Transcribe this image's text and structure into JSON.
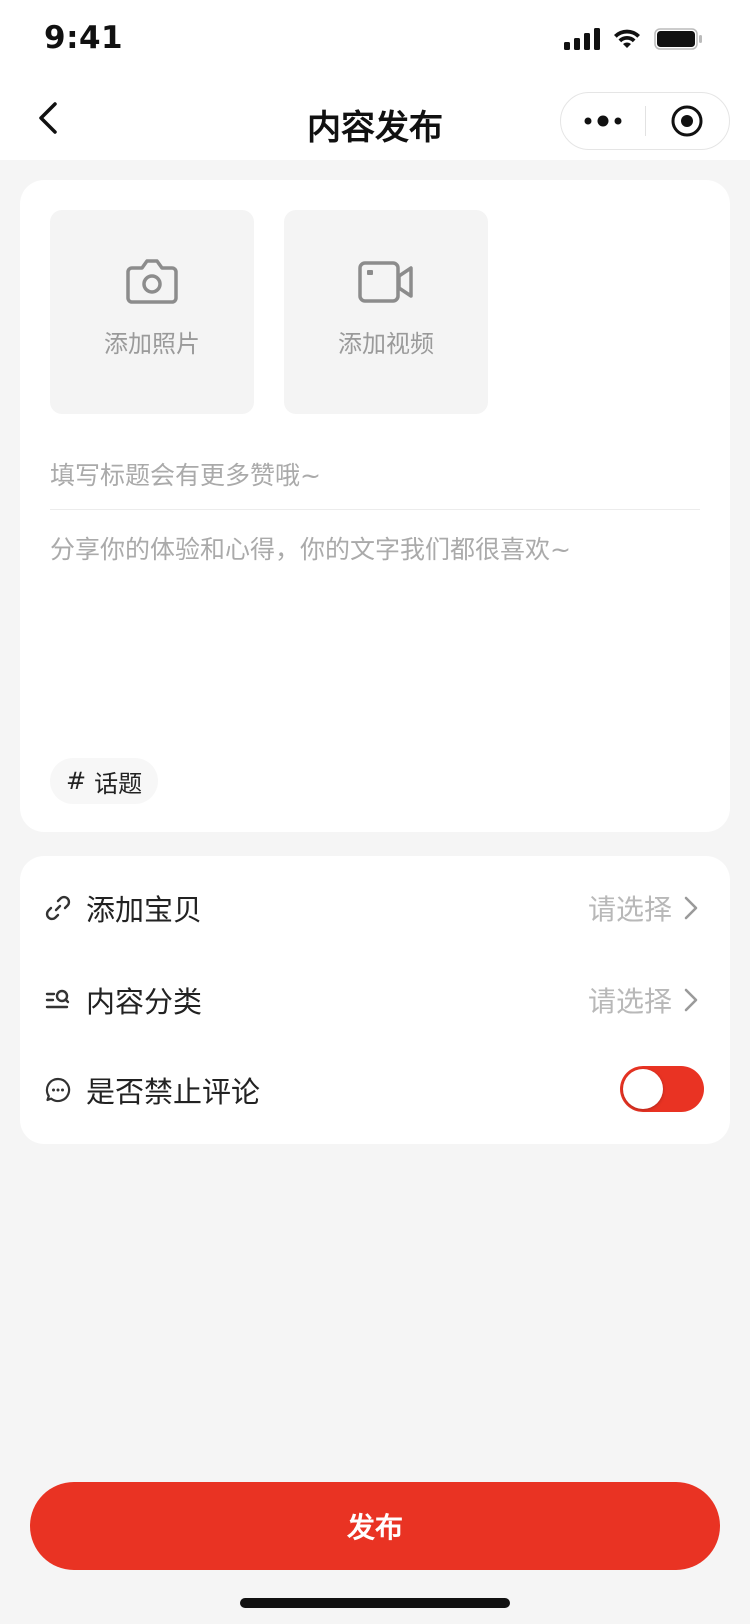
{
  "status_bar": {
    "time": "9:41"
  },
  "nav": {
    "title": "内容发布"
  },
  "media": {
    "add_photo_label": "添加照片",
    "add_video_label": "添加视频"
  },
  "compose": {
    "title_placeholder": "填写标题会有更多赞哦~",
    "title_value": "",
    "content_placeholder": "分享你的体验和心得，你的文字我们都很喜欢~",
    "content_value": "",
    "topic_symbol": "#",
    "topic_label": "话题"
  },
  "options": {
    "add_product": {
      "label": "添加宝贝",
      "value": "请选择"
    },
    "category": {
      "label": "内容分类",
      "value": "请选择"
    },
    "disable_comments": {
      "label": "是否禁止评论",
      "enabled": true
    }
  },
  "actions": {
    "publish_label": "发布"
  },
  "colors": {
    "accent": "#e93323",
    "background": "#f5f5f5",
    "card": "#ffffff",
    "placeholder": "#aaaaaa"
  },
  "icons": [
    "back-arrow-icon",
    "more-dots-icon",
    "target-icon",
    "camera-icon",
    "video-camera-icon",
    "link-icon",
    "category-list-icon",
    "comment-bubble-icon",
    "chevron-right-icon"
  ]
}
